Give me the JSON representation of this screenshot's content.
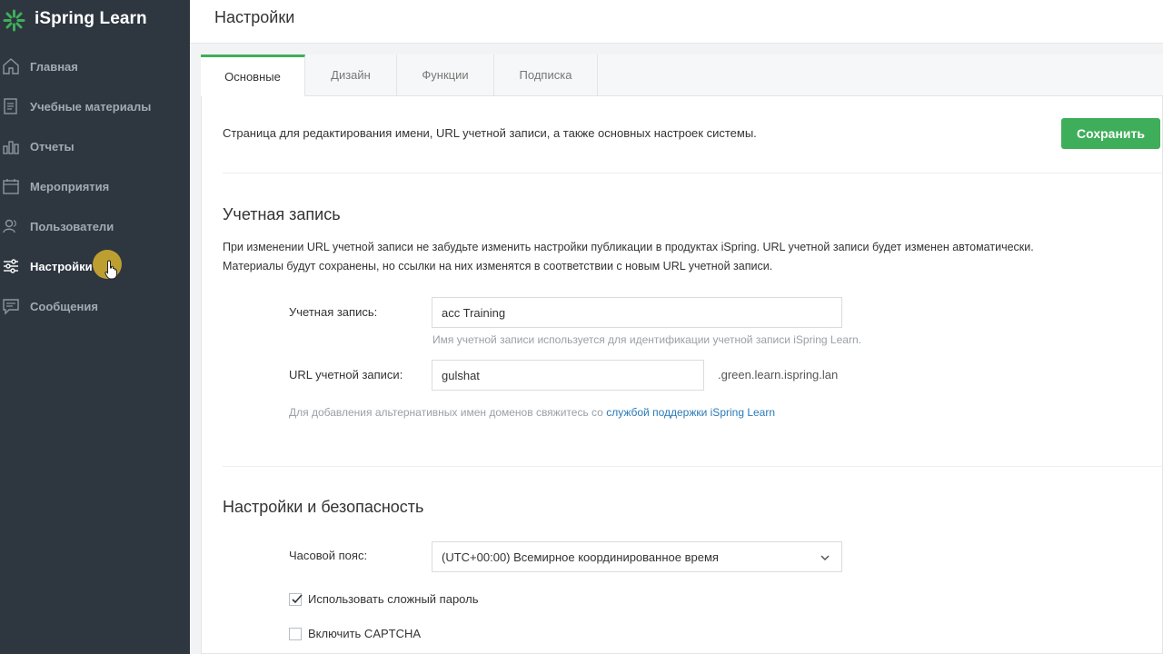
{
  "app": {
    "name": "iSpring Learn"
  },
  "sidebar": {
    "items": [
      {
        "label": "Главная",
        "icon": "home-icon"
      },
      {
        "label": "Учебные материалы",
        "icon": "book-icon"
      },
      {
        "label": "Отчеты",
        "icon": "bar-chart-icon"
      },
      {
        "label": "Мероприятия",
        "icon": "calendar-icon"
      },
      {
        "label": "Пользователи",
        "icon": "users-icon"
      },
      {
        "label": "Настройки",
        "icon": "sliders-icon",
        "active": true
      },
      {
        "label": "Сообщения",
        "icon": "message-icon"
      }
    ]
  },
  "header": {
    "title": "Настройки"
  },
  "tabs": [
    {
      "label": "Основные",
      "active": true
    },
    {
      "label": "Дизайн"
    },
    {
      "label": "Функции"
    },
    {
      "label": "Подписка"
    }
  ],
  "intro": "Страница для редактирования имени, URL учетной записи, а также основных настроек системы.",
  "save_label": "Сохранить",
  "account": {
    "title": "Учетная запись",
    "help_line1": "При изменении URL учетной записи не забудьте изменить настройки публикации в продуктах iSpring. URL учетной записи будет изменен автоматически.",
    "help_line2": "Материалы будут сохранены, но ссылки на них изменятся в соответствии с новым URL учетной записи.",
    "name_label": "Учетная запись:",
    "name_value": "acc Training",
    "name_hint": "Имя учетной записи используется для идентификации учетной записи iSpring Learn.",
    "url_label": "URL учетной записи:",
    "url_value": "gulshat",
    "url_suffix": ".green.learn.ispring.lan",
    "domain_hint": "Для добавления альтернативных имен доменов свяжитесь со",
    "domain_link": "службой поддержки iSpring Learn"
  },
  "security": {
    "title": "Настройки и безопасность",
    "timezone_label": "Часовой пояс:",
    "timezone_value": "(UTC+00:00) Всемирное координированное время",
    "complex_password_label": "Использовать сложный пароль",
    "complex_password_checked": true,
    "captcha_label": "Включить CAPTCHA",
    "captcha_checked": false
  },
  "colors": {
    "accent": "#3fae5a",
    "sidebar_bg": "#2e3640",
    "link": "#2a7ab8"
  }
}
